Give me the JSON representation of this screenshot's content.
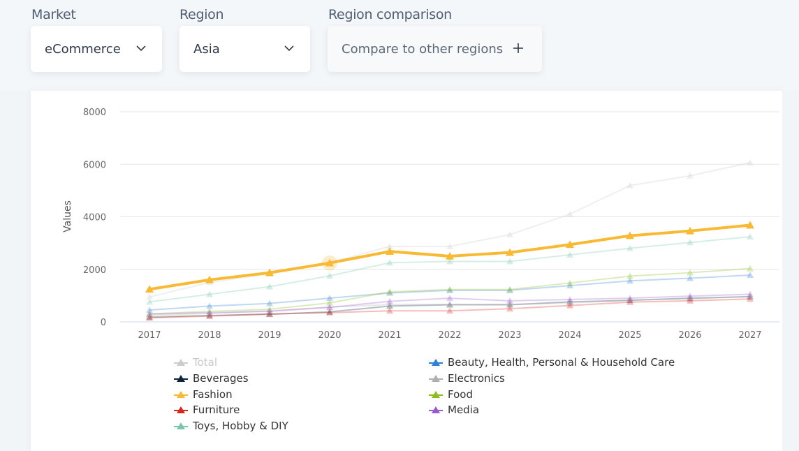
{
  "filters": {
    "market": {
      "label": "Market",
      "value": "eCommerce",
      "icon": "chevron-down-icon"
    },
    "region": {
      "label": "Region",
      "value": "Asia",
      "icon": "chevron-down-icon"
    },
    "comparison": {
      "label": "Region comparison",
      "value": "Compare to other regions",
      "icon": "plus-icon"
    }
  },
  "chart_data": {
    "type": "line",
    "title": "",
    "xlabel": "",
    "ylabel": "Values",
    "ylim": [
      0,
      8000
    ],
    "yticks": [
      0,
      2000,
      4000,
      6000,
      8000
    ],
    "grid": true,
    "legend_position": "bottom",
    "categories": [
      "2017",
      "2018",
      "2019",
      "2020",
      "2021",
      "2022",
      "2023",
      "2024",
      "2025",
      "2026",
      "2027"
    ],
    "series": [
      {
        "name": "Total",
        "color": "#d0d0d0",
        "visible": false,
        "values": [
          950,
          1500,
          1830,
          2250,
          2870,
          2870,
          3320,
          4100,
          5190,
          5560,
          6060
        ]
      },
      {
        "name": "Beauty, Health, Personal & Household Care",
        "color": "#2f7ed8",
        "visible": true,
        "values": [
          450,
          600,
          700,
          900,
          1100,
          1200,
          1200,
          1380,
          1560,
          1660,
          1780
        ]
      },
      {
        "name": "Beverages",
        "color": "#0d233a",
        "visible": true,
        "values": [
          180,
          240,
          290,
          380,
          600,
          650,
          650,
          760,
          820,
          900,
          960
        ]
      },
      {
        "name": "Electronics",
        "color": "#b0b0b0",
        "visible": true,
        "values": [
          250,
          320,
          420,
          560,
          660,
          660,
          660,
          720,
          820,
          880,
          960
        ]
      },
      {
        "name": "Fashion",
        "color": "#f8b933",
        "visible": true,
        "highlighted": true,
        "values": [
          1240,
          1600,
          1870,
          2240,
          2680,
          2500,
          2640,
          2940,
          3280,
          3460,
          3680
        ]
      },
      {
        "name": "Food",
        "color": "#8bbc21",
        "visible": true,
        "values": [
          300,
          400,
          480,
          720,
          1140,
          1230,
          1230,
          1480,
          1740,
          1870,
          2030
        ]
      },
      {
        "name": "Furniture",
        "color": "#d6271c",
        "visible": true,
        "values": [
          150,
          220,
          300,
          350,
          420,
          420,
          500,
          620,
          750,
          800,
          870
        ]
      },
      {
        "name": "Media",
        "color": "#9b59d0",
        "visible": true,
        "values": [
          300,
          350,
          400,
          550,
          780,
          900,
          800,
          850,
          900,
          980,
          1050
        ]
      },
      {
        "name": "Toys, Hobby & DIY",
        "color": "#76c7a8",
        "visible": true,
        "values": [
          760,
          1050,
          1340,
          1750,
          2250,
          2300,
          2300,
          2550,
          2800,
          3020,
          3240
        ]
      }
    ]
  }
}
